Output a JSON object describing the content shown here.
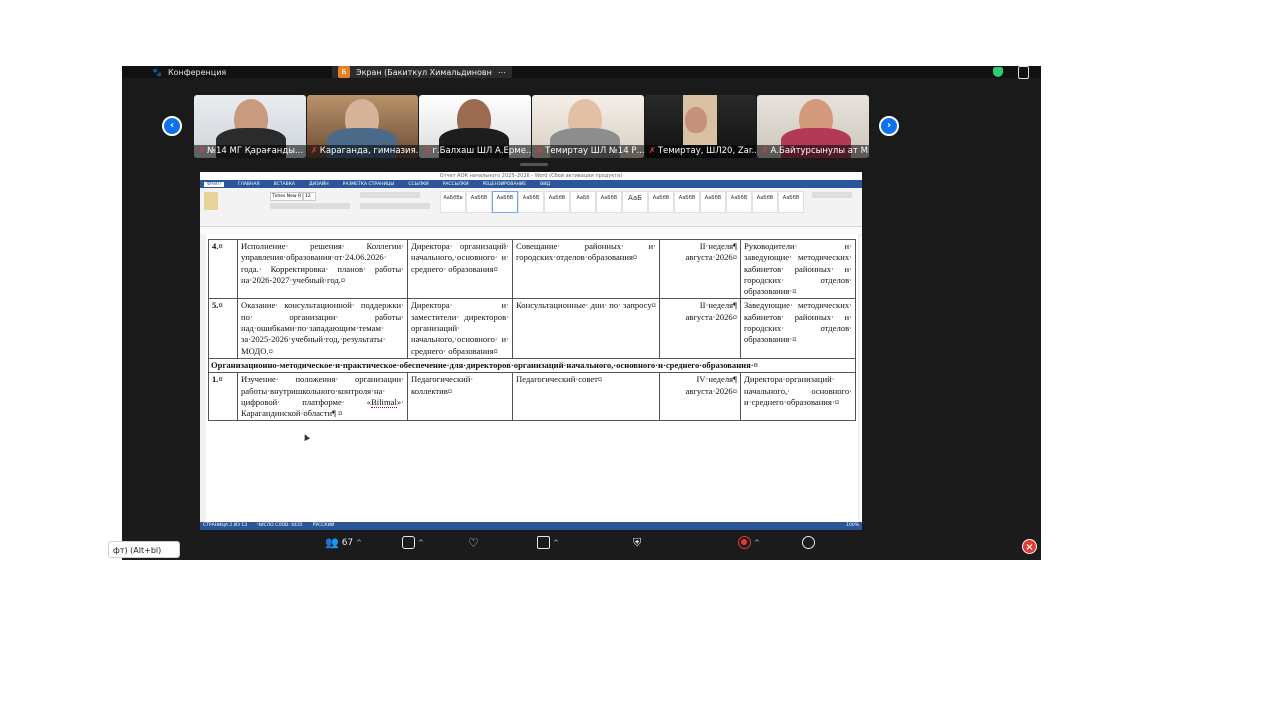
{
  "app": {
    "conference_label": "Конференция",
    "share_badge": "Б",
    "share_title": "Экран (Бакиткул Химальдиновн"
  },
  "participants": [
    {
      "name": "№14 МГ Қарағанды..."
    },
    {
      "name": "Караганда, гимназия..."
    },
    {
      "name": "г.Балхаш ШЛ А.Ерме..."
    },
    {
      "name": "Темиртау ШЛ №14 Р..."
    },
    {
      "name": "Темиртау, ШЛ20, Zar..."
    },
    {
      "name": "А.Байтурсынулы ат МГ..."
    }
  ],
  "word": {
    "window_title": "Отчет АОК начального 2025–2026 - Word (Сбой активации продукта)",
    "menu": [
      "ФАЙЛ",
      "ГЛАВНАЯ",
      "ВСТАВКА",
      "ДИЗАЙН",
      "РАЗМЕТКА СТРАНИЦЫ",
      "ССЫЛКИ",
      "РАССЫЛКИ",
      "РЕЦЕНЗИРОВАНИЕ",
      "ВИД"
    ],
    "font_name": "Times New R",
    "font_size": "12",
    "style_tiles": [
      "АаБбВв",
      "АаБбВ",
      "АаБбВ",
      "АаБбВ",
      "АаБбВ",
      "АаБб",
      "АаБбВ",
      "АаБ",
      "АаБбВ",
      "АаБбВ",
      "АаБбВ",
      "АаБбВ",
      "АаБбВ",
      "АаБбВ"
    ],
    "status_page": "СТРАНИЦА 2 ИЗ 13",
    "status_words": "ЧИСЛО СЛОВ: 6435",
    "status_lang": "РУССКИЙ",
    "zoom": "100%"
  },
  "table": {
    "rows": [
      {
        "num": "4.¤",
        "c2": "Исполнение· решения· Коллегии· управления·образования·от·24.06.2026· года.· Корректировка· планов· работы· на·2026-2027·учебный·год.¤",
        "c3": "Директора· организаций· начального,·основного· и· среднего· образования¤",
        "c4": "Совещание· районных· и· городских·отделов·образования¤",
        "c5": "II·неделя¶ августа·2026¤",
        "c6": "Руководители· и· заведующие· методических· кабинетов· районных· и· городских· отделов· образования·¤"
      },
      {
        "num": "5.¤",
        "c2": "Оказание· консультационной· поддержки· по· организации· работы· над·ошибками·по·западающим·темам· за·2025-2026·учебный·год,·результаты· МОДО.¤",
        "c3": "Директора· и· заместители· директоров· организаций· начального,·основного· и· среднего· образования¤",
        "c4": "Консультационные· дни· по· запросу¤",
        "c5": "II·неделя¶ августа·2026¤",
        "c6": "Заведующие· методических· кабинетов· районных· и· городских· отделов· образования·¤"
      }
    ],
    "section_title": "Организационно-методическое·и·практическое·обеспечение·для·директоров·организаций·начального,·основного·и·среднего·образования·¤",
    "rows2": [
      {
        "num": "1.¤",
        "c2_pre": "Изучение· положения· организации· работы·внутришкольного·контроля·на· цифровой· платформе· «",
        "c2_u": "Bilimal",
        "c2_post": "»· Карагандинской·области¶ ¤",
        "c3": "Педагогический· коллектив¤",
        "c4": "Педагогический·совет¤",
        "c5": "IV·неделя¶ августа·2026¤",
        "c6": "Директора·организаций· начального,· основного· и·среднего·образования·¤"
      }
    ]
  },
  "toolbar": {
    "participants_count": "67"
  },
  "tooltip": {
    "text": "фт) (Alt+bl)"
  }
}
